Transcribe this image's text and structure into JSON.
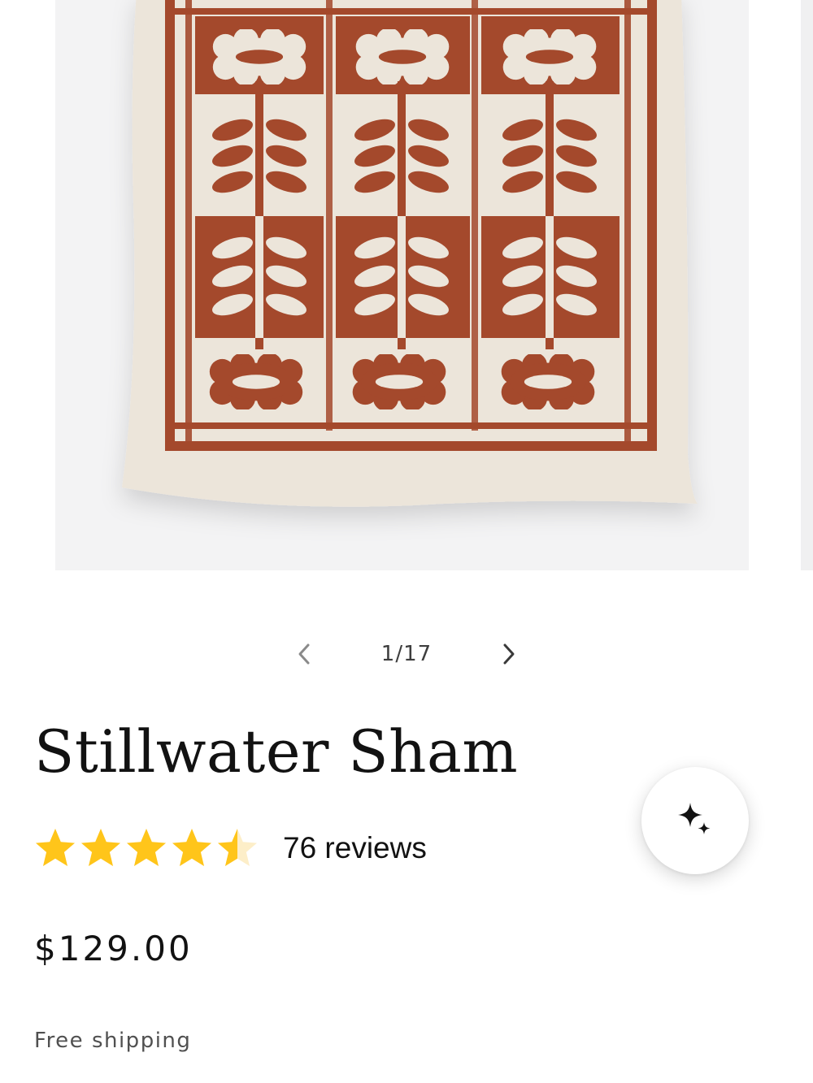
{
  "gallery": {
    "alt": "Stillwater Sham product photo",
    "colors": {
      "fabric": "#ece5da",
      "pattern": "#a4492c",
      "background": "#f3f3f4"
    }
  },
  "slider": {
    "counter": "1/17",
    "prev_icon": "chevron-left-icon",
    "next_icon": "chevron-right-icon"
  },
  "product": {
    "title": "Stillwater Sham",
    "rating": {
      "value": 4.5,
      "max": 5,
      "reviews_label": "76 reviews",
      "star_color": "#ffc51a"
    },
    "price": "$129.00",
    "shipping": "Free shipping"
  },
  "ai_button": {
    "icon": "sparkle-icon"
  }
}
